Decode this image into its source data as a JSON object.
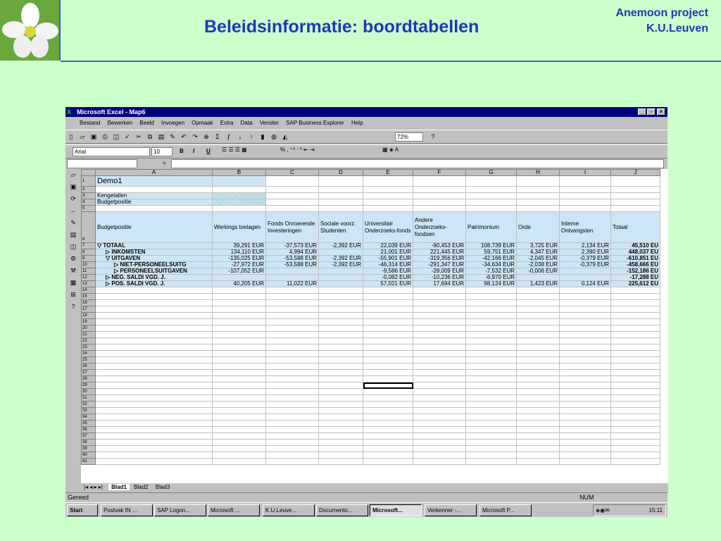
{
  "slide": {
    "title": "Beleidsinformatie: boordtabellen",
    "project_line1": "Anemoon project",
    "project_line2": "K.U.Leuven"
  },
  "window": {
    "title": "Microsoft Excel - Map6",
    "menu": [
      "Bestand",
      "Bewerken",
      "Beeld",
      "Invoegen",
      "Opmaak",
      "Extra",
      "Data",
      "Venster",
      "SAP Business Explorer",
      "Help"
    ],
    "font_name": "Arial",
    "font_size": "10",
    "zoom": "72%",
    "bold": "B",
    "italic": "I",
    "underline": "U",
    "formula_eq": "="
  },
  "columns": [
    "A",
    "B",
    "C",
    "D",
    "E",
    "F",
    "G",
    "H",
    "I",
    "J"
  ],
  "rows": {
    "r1": "Demo1",
    "r3": "Kengetallen",
    "r4": "Budgetpositie",
    "r6_a": "Budgetpositie"
  },
  "headers": [
    "Werkings toelagen",
    "Fonds Onroerende Investeringen",
    "Sociale voorz. Studenten",
    "Universitair Onderzoeks-fonds",
    "Andere Onderzoeks-fondsen",
    "Patrimonium",
    "Orde",
    "Interne Ontvangsten",
    "Totaal"
  ],
  "data_rows": [
    {
      "label": "▽ TOTAAL",
      "b": "39,291 EUR",
      "c": "-37,573 EUR",
      "d": "-2,392 EUR",
      "e": "22,039 EUR",
      "f": "-90,453 EUR",
      "g": "108,739 EUR",
      "h": "3,725 EUR",
      "i": "2,134 EUR",
      "j": "45,510 EU"
    },
    {
      "label": "▷ INKOMSTEN",
      "b": "134,110 EUR",
      "c": "4,994 EUR",
      "d": "",
      "e": "21,001 EUR",
      "f": "221,445 EUR",
      "g": "59,751 EUR",
      "h": "4,347 EUR",
      "i": "2,390 EUR",
      "j": "448,037 EU"
    },
    {
      "label": "▽ UITGAVEN",
      "b": "-135,025 EUR",
      "c": "-53,588 EUR",
      "d": "-2,392 EUR",
      "e": "-55,901 EUR",
      "f": "-319,356 EUR",
      "g": "-42,166 EUR",
      "h": "-2,045 EUR",
      "i": "-0,379 EUR",
      "j": "-610,851 EU"
    },
    {
      "label": "▷ NIET-PERSONEELSUITG",
      "b": "-27,972 EUR",
      "c": "-53,588 EUR",
      "d": "-2,392 EUR",
      "e": "-46,314 EUR",
      "f": "-291,347 EUR",
      "g": "-34,634 EUR",
      "h": "-2,038 EUR",
      "i": "-0,379 EUR",
      "j": "-458,666 EU"
    },
    {
      "label": "▷ PERSONEELSUITGAVEN",
      "b": "-107,052 EUR",
      "c": "",
      "d": "",
      "e": "-9,586 EUR",
      "f": "-28,009 EUR",
      "g": "-7,532 EUR",
      "h": "-0,006 EUR",
      "i": "",
      "j": "-152,186 EU"
    },
    {
      "label": "▷ NEG. SALDI VGD. J.",
      "b": "",
      "c": "",
      "d": "",
      "e": "-0,082 EUR",
      "f": "-10,236 EUR",
      "g": "-6,970 EUR",
      "h": "",
      "i": "",
      "j": "-17,288 EU"
    },
    {
      "label": "▷ POS. SALDI VGD. J.",
      "b": "40,205 EUR",
      "c": "11,022 EUR",
      "d": "",
      "e": "57,021 EUR",
      "f": "17,694 EUR",
      "g": "98,124 EUR",
      "h": "1,423 EUR",
      "i": "0,124 EUR",
      "j": "225,612 EU"
    }
  ],
  "sheet_tabs": [
    "Blad1",
    "Blad2",
    "Blad3"
  ],
  "status": {
    "ready": "Gereed",
    "num": "NUM"
  },
  "taskbar": {
    "start": "Start",
    "items": [
      "Postvak IN ...",
      "SAP Logon...",
      "Microsoft ...",
      "K.U.Leuve...",
      "Documento...",
      "Microsoft...",
      "Verkenner -...",
      "Microsoft P..."
    ],
    "clock": "15:11"
  }
}
